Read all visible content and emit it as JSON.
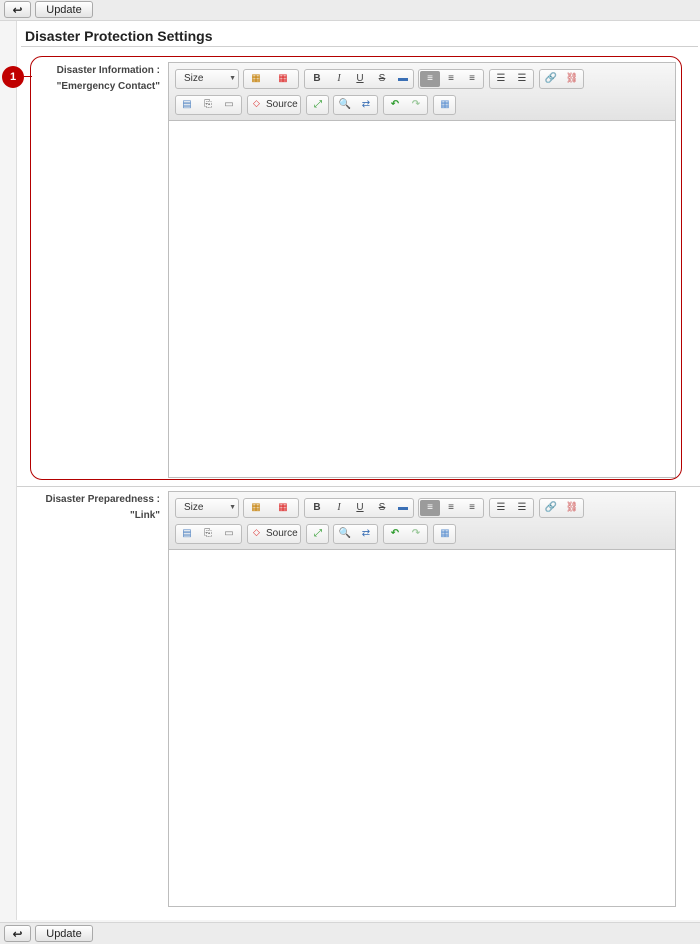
{
  "toolbar": {
    "back_icon": "back-arrow-icon",
    "back_glyph": "↩",
    "update_label": "Update"
  },
  "page": {
    "title": "Disaster Protection Settings"
  },
  "annotation": {
    "marker": "1"
  },
  "fields": [
    {
      "label_line1": "Disaster Information :",
      "label_line2": "\"Emergency Contact\""
    },
    {
      "label_line1": "Disaster Preparedness :",
      "label_line2": "\"Link\""
    }
  ],
  "editor_toolbar": {
    "size_label": "Size",
    "source_label": "Source",
    "glyphs": {
      "bold": "B",
      "italic": "I",
      "underline": "U",
      "strike": "S",
      "align": "≡",
      "ol": "☰",
      "ul": "☰",
      "link": "🔗",
      "unlink": "⛓",
      "maximize": "⤢",
      "find": "🔍",
      "replace": "⇄",
      "undo": "↶",
      "redo": "↷",
      "table": "▦",
      "color": "▦",
      "source_icon": "◇"
    }
  },
  "colors": {
    "accent": "#b30000",
    "panel_bg": "#ffffff",
    "page_bg": "#f5f5f5"
  }
}
